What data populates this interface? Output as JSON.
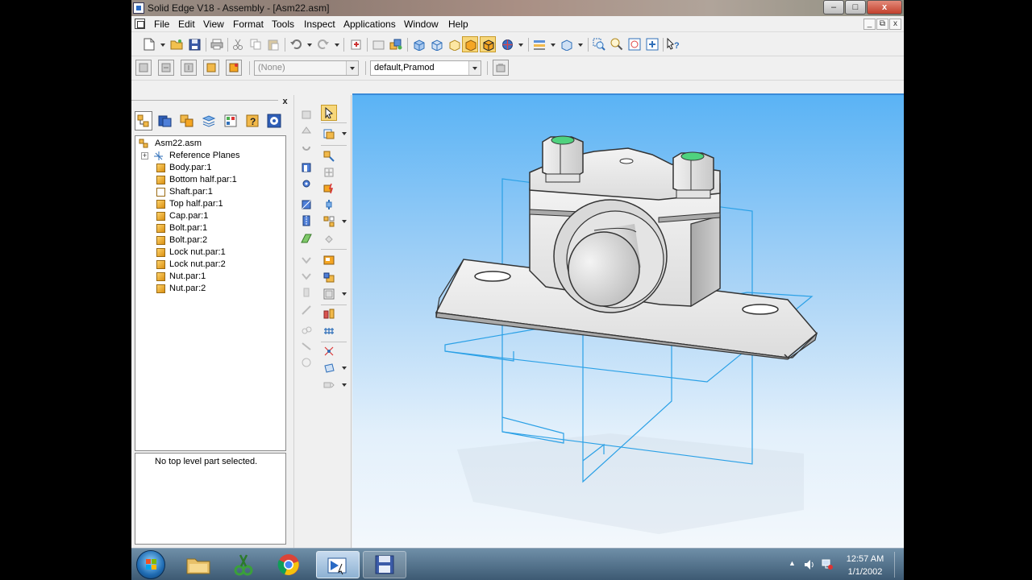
{
  "window": {
    "title": "Solid Edge V18 - Assembly - [Asm22.asm]",
    "controls": {
      "minimize": "–",
      "maximize": "□",
      "close": "x"
    }
  },
  "menu": [
    "File",
    "Edit",
    "View",
    "Format",
    "Tools",
    "Inspect",
    "Applications",
    "Window",
    "Help"
  ],
  "mdi_controls": {
    "minimize": "_",
    "restore": "⧉",
    "close": "x"
  },
  "toolbar2": {
    "layer_combo": "(None)",
    "config_combo": "default,Pramod"
  },
  "pathfinder": {
    "close_label": "x",
    "root": "Asm22.asm",
    "items": [
      {
        "label": "Reference Planes",
        "type": "planes"
      },
      {
        "label": "Body.par:1",
        "type": "part"
      },
      {
        "label": "Bottom half.par:1",
        "type": "part"
      },
      {
        "label": "Shaft.par:1",
        "type": "part"
      },
      {
        "label": "Top half.par:1",
        "type": "part"
      },
      {
        "label": "Cap.par:1",
        "type": "part"
      },
      {
        "label": "Bolt.par:1",
        "type": "part"
      },
      {
        "label": "Bolt.par:2",
        "type": "part"
      },
      {
        "label": "Lock nut.par:1",
        "type": "part"
      },
      {
        "label": "Lock nut.par:2",
        "type": "part"
      },
      {
        "label": "Nut.par:1",
        "type": "part"
      },
      {
        "label": "Nut.par:2",
        "type": "part"
      }
    ],
    "status_message": "No top level part selected."
  },
  "taskbar": {
    "apps": [
      "start-button",
      "file-explorer",
      "scissors-app",
      "chrome",
      "solid-edge",
      "floppy-app"
    ],
    "time": "12:57 AM",
    "date": "1/1/2002"
  },
  "colors": {
    "viewport_top": "#5ab3f5",
    "viewport_bottom": "#f3f8fc",
    "model_face": "#e6e6e6",
    "plane_lines": "#2aa0e6",
    "active_button": "#f7d77a"
  }
}
